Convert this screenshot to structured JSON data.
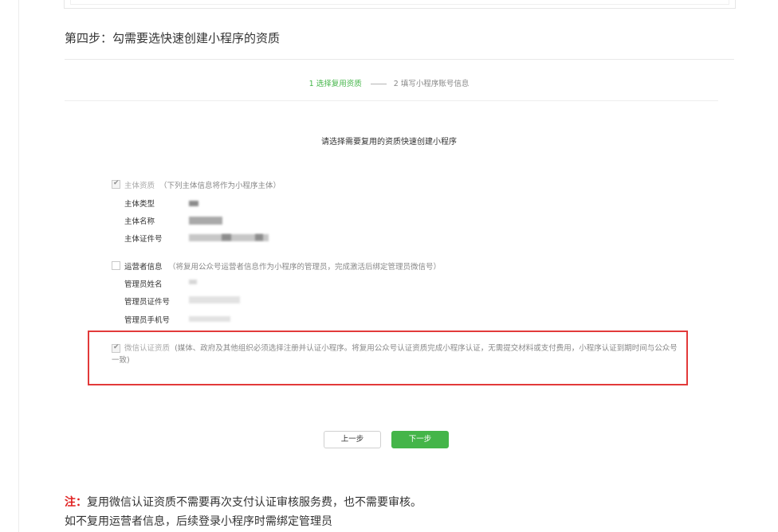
{
  "step_heading": "第四步：勾需要选快速创建小程序的资质",
  "progress": {
    "step1": "1 选择复用资质",
    "step2": "2 填写小程序账号信息"
  },
  "form_title": "请选择需要复用的资质快速创建小程序",
  "subject": {
    "label": "主体资质",
    "note": "（下列主体信息将作为小程序主体）",
    "checked": true,
    "fields": [
      {
        "label": "主体类型"
      },
      {
        "label": "主体名称"
      },
      {
        "label": "主体证件号"
      }
    ]
  },
  "operator": {
    "label": "运营者信息",
    "note": "（将复用公众号运营者信息作为小程序的管理员，完成激活后绑定管理员微信号）",
    "checked": false,
    "fields": [
      {
        "label": "管理员姓名"
      },
      {
        "label": "管理员证件号"
      },
      {
        "label": "管理员手机号"
      }
    ]
  },
  "wechat_cert": {
    "label": "微信认证资质",
    "note": "(媒体、政府及其他组织必须选择注册并认证小程序。将复用公众号认证资质完成小程序认证，无需提交材料或支付费用，小程序认证到期时间与公众号一致)",
    "checked": true
  },
  "buttons": {
    "prev": "上一步",
    "next": "下一步"
  },
  "footnote": {
    "prefix": "注：",
    "line1": "复用微信认证资质不需要再次支付认证审核服务费，也不需要审核。",
    "line2": "如不复用运营者信息，后续登录小程序时需绑定管理员"
  },
  "colors": {
    "accent_green": "#44b549",
    "highlight_red": "#e23a3a",
    "note_red": "#e02020"
  }
}
